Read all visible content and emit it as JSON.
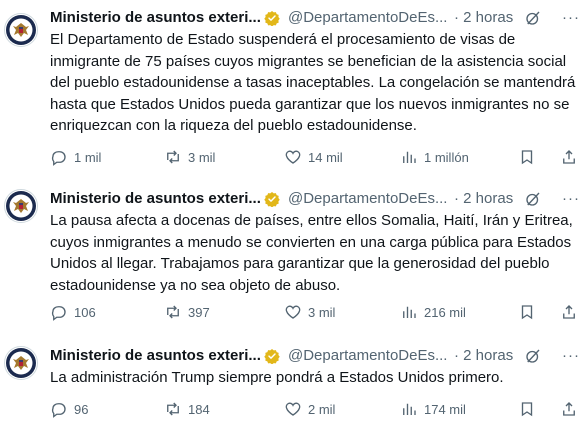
{
  "tweets": [
    {
      "name": "Ministerio de asuntos exteri...",
      "handle": "@DepartamentoDeEs...",
      "time": "· 2 horas",
      "more": "···",
      "text": "El Departamento de Estado suspenderá el procesamiento de visas de inmigrante de 75 países cuyos migrantes se benefician de la asistencia social del pueblo estadounidense a tasas inaceptables. La congelación se mantendrá hasta que Estados Unidos pueda garantizar que los nuevos inmigrantes no se enriquezcan con la riqueza del pueblo estadounidense.",
      "replies": "1 mil",
      "retweets": "3 mil",
      "likes": "14 mil",
      "views": "1 millón"
    },
    {
      "name": "Ministerio de asuntos exteri...",
      "handle": "@DepartamentoDeEs...",
      "time": "· 2 horas",
      "more": "···",
      "text": "La pausa afecta a docenas de países, entre ellos Somalia, Haití, Irán y Eritrea, cuyos inmigrantes a menudo se convierten en una carga pública para Estados Unidos al llegar. Trabajamos para garantizar que la generosidad del pueblo estadounidense ya no sea objeto de abuso.",
      "replies": "106",
      "retweets": "397",
      "likes": "3 mil",
      "views": "216 mil"
    },
    {
      "name": "Ministerio de asuntos exteri...",
      "handle": "@DepartamentoDeEs...",
      "time": "· 2 horas",
      "more": "···",
      "text": "La administración Trump siempre pondrá a Estados Unidos primero.",
      "replies": "96",
      "retweets": "184",
      "likes": "2 mil",
      "views": "174 mil"
    }
  ],
  "icons": {
    "avatar": "us-state-department-seal-icon",
    "verified": "verified-badge-icon",
    "grok": "grok-icon",
    "reply": "reply-icon",
    "retweet": "retweet-icon",
    "like": "heart-icon",
    "views": "views-chart-icon",
    "bookmark": "bookmark-icon",
    "share": "share-icon"
  },
  "colors": {
    "text": "#0f1419",
    "secondary": "#536471",
    "verified_gold": "#e2b719",
    "divider": "#eff3f4"
  }
}
